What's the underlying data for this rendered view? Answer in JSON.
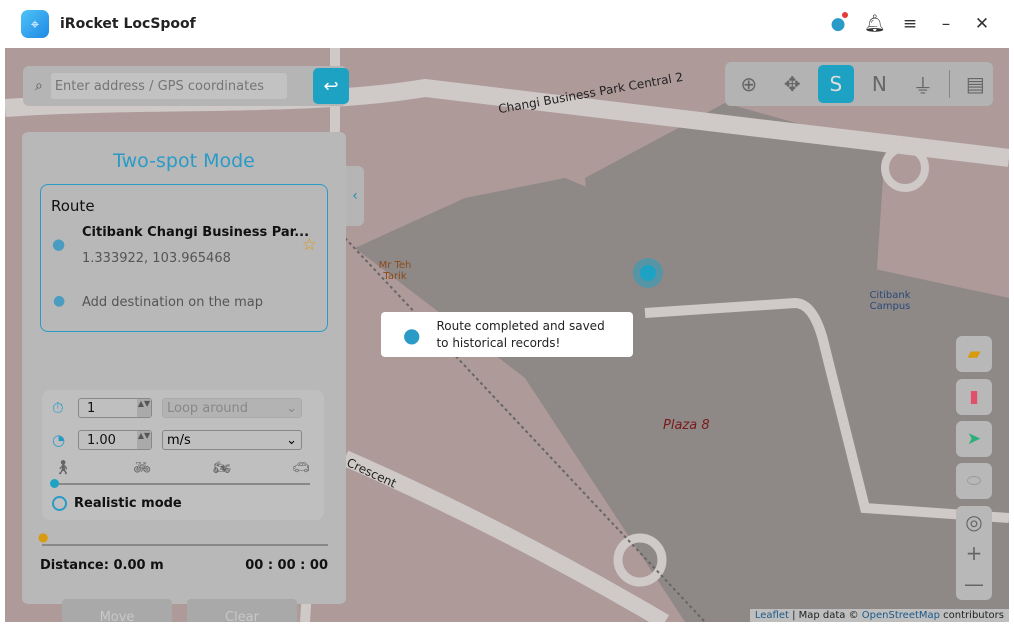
{
  "app": {
    "title": "iRocket LocSpoof"
  },
  "search": {
    "placeholder": "Enter address / GPS coordinates"
  },
  "modes": [
    "teleport-mode",
    "joystick-move",
    "two-spot-mode",
    "multi-spot-mode",
    "joystick-mode",
    "history"
  ],
  "panel": {
    "title": "Two-spot Mode",
    "route_heading": "Route",
    "start_name": "Citibank Changi Business Par...",
    "start_coords": "1.333922, 103.965468",
    "add_destination": "Add destination on the map",
    "times": "1",
    "loop_mode": "Loop around",
    "speed": "1.00",
    "speed_unit": "m/s",
    "realistic_mode": "Realistic mode",
    "distance": "Distance: 0.00 m",
    "time": "00 : 00 : 00",
    "move": "Move",
    "clear": "Clear"
  },
  "toast": {
    "message": "Route completed and saved to historical records!"
  },
  "map": {
    "road1": "Changi Business Park Central 2",
    "poi1": "Mr Teh Tarik",
    "poi2": "Citibank Campus",
    "building": "Plaza 8",
    "street2": "Crescent",
    "attribution": {
      "leaflet": "Leaflet",
      "sep": " | Map data © ",
      "osm": "OpenStreetMap",
      "contrib": " contributors"
    }
  },
  "colors": {
    "accent": "#1ea2c4",
    "star": "#d99a10"
  }
}
